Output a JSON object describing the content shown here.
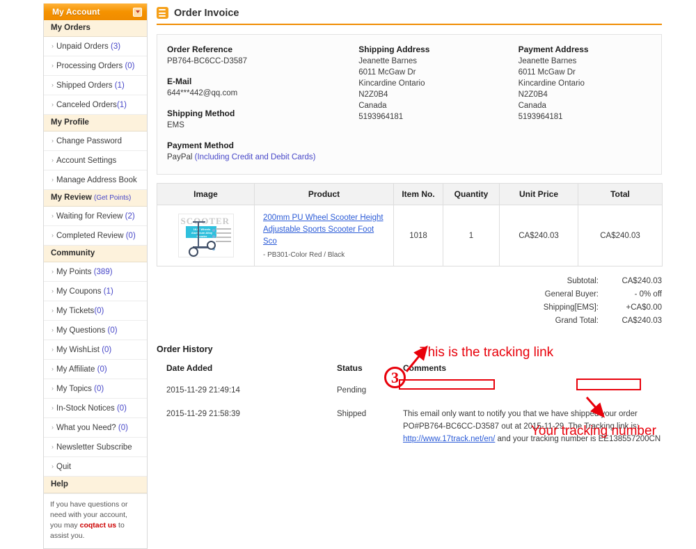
{
  "sidebar": {
    "header": {
      "title": "My Account",
      "toggle_icon": "chevron-down-icon"
    },
    "sections": [
      {
        "title": "My Orders",
        "items": [
          {
            "label": "Unpaid Orders",
            "count": "(3)"
          },
          {
            "label": "Processing Orders",
            "count": "(0)"
          },
          {
            "label": "Shipped Orders",
            "count": "(1)"
          },
          {
            "label": "Canceled Orders",
            "count": "(1)",
            "nospace": true
          }
        ]
      },
      {
        "title": "My Profile",
        "items": [
          {
            "label": "Change Password",
            "count": ""
          },
          {
            "label": "Account Settings",
            "count": ""
          },
          {
            "label": "Manage Address Book",
            "count": ""
          }
        ]
      },
      {
        "title": "My Review",
        "subtitle": "(Get Points)",
        "items": [
          {
            "label": "Waiting for Review",
            "count": "(2)"
          },
          {
            "label": "Completed Review",
            "count": "(0)"
          }
        ]
      },
      {
        "title": "Community",
        "items": [
          {
            "label": "My Points",
            "count": "(389)"
          },
          {
            "label": "My Coupons",
            "count": "(1)"
          },
          {
            "label": "My Tickets",
            "count": "(0)",
            "nospace": true
          },
          {
            "label": "My Questions",
            "count": "(0)"
          },
          {
            "label": "My WishList",
            "count": "(0)"
          },
          {
            "label": "My Affiliate",
            "count": "(0)"
          },
          {
            "label": "My Topics",
            "count": "(0)"
          },
          {
            "label": "In-Stock Notices",
            "count": "(0)"
          },
          {
            "label": "What you Need?",
            "count": "(0)"
          },
          {
            "label": "Newsletter Subscribe",
            "count": ""
          },
          {
            "label": "Quit",
            "count": ""
          }
        ]
      },
      {
        "title": "Help",
        "items": []
      }
    ],
    "help_text_before": "If you have questions or need with your account, you may ",
    "help_contact_link": "coqtact us",
    "help_text_after": " to assist you."
  },
  "page": {
    "title": "Order Invoice",
    "icon": "invoice-list-icon"
  },
  "order_info": {
    "order_reference_label": "Order Reference",
    "order_reference_value": "PB764-BC6CC-D3587",
    "email_label": "E-Mail",
    "email_value": "644***442@qq.com",
    "shipping_method_label": "Shipping Method",
    "shipping_method_value": "EMS",
    "payment_method_label": "Payment Method",
    "payment_method_value": "PayPal ",
    "payment_method_note": "(Including Credit and Debit Cards)",
    "shipping_address_label": "Shipping Address",
    "shipping_address_lines": [
      "Jeanette Barnes",
      "6011 McGaw Dr",
      "Kincardine Ontario",
      "N2Z0B4",
      "Canada",
      "5193964181"
    ],
    "payment_address_label": "Payment Address",
    "payment_address_lines": [
      "Jeanette Barnes",
      "6011 McGaw Dr",
      "Kincardine Ontario",
      "N2Z0B4",
      "Canada",
      "5193964181"
    ]
  },
  "products_table": {
    "headers": [
      "Image",
      "Product",
      "Item No.",
      "Quantity",
      "Unit Price",
      "Total"
    ],
    "rows": [
      {
        "image_alt": "200mm PU Wheel Scooter product photo",
        "image_caption": "SCOOTER",
        "image_badge": "16.8\" Wheels Aluminum Alloy Scooter",
        "product_name": "200mm PU Wheel Scooter Height Adjustable Sports Scooter Foot Sco",
        "product_option": "- PB301-Color Red / Black",
        "item_no": "1018",
        "quantity": "1",
        "unit_price": "CA$240.03",
        "total": "CA$240.03"
      }
    ]
  },
  "totals": [
    {
      "label": "Subtotal:",
      "value": "CA$240.03"
    },
    {
      "label": "General Buyer:",
      "value": "- 0% off"
    },
    {
      "label": "Shipping[EMS]:",
      "value": "+CA$0.00"
    },
    {
      "label": "Grand Total:",
      "value": "CA$240.03"
    }
  ],
  "order_history": {
    "title": "Order History",
    "headers": [
      "Date Added",
      "Status",
      "Comments"
    ],
    "rows": [
      {
        "date": "2015-11-29 21:49:14",
        "status": "Pending",
        "comment_part1": "",
        "comment_link": "",
        "comment_part2": "",
        "comment_number": ""
      },
      {
        "date": "2015-11-29 21:58:39",
        "status": "Shipped",
        "comment_part1": "This email only want to notify you that we have shipped your order PO#PB764-BC6CC-D3587 out at 2015-11-29, The Tracking link is: ",
        "comment_link": "http://www.17track.net/en/",
        "comment_part2": " and your tracking number is ",
        "comment_number": "EE138557200CN"
      }
    ]
  },
  "annotations": {
    "step_number": "3",
    "tracking_link_label": "This is the tracking link",
    "tracking_number_label": "Your tracking number",
    "color": "#e8000a"
  },
  "colors": {
    "brand_orange": "#f08c00",
    "link_blue": "#2b5bd7",
    "count_blue": "#4646c8",
    "annotation_red": "#e8000a",
    "section_bg": "#fdf2dc"
  }
}
